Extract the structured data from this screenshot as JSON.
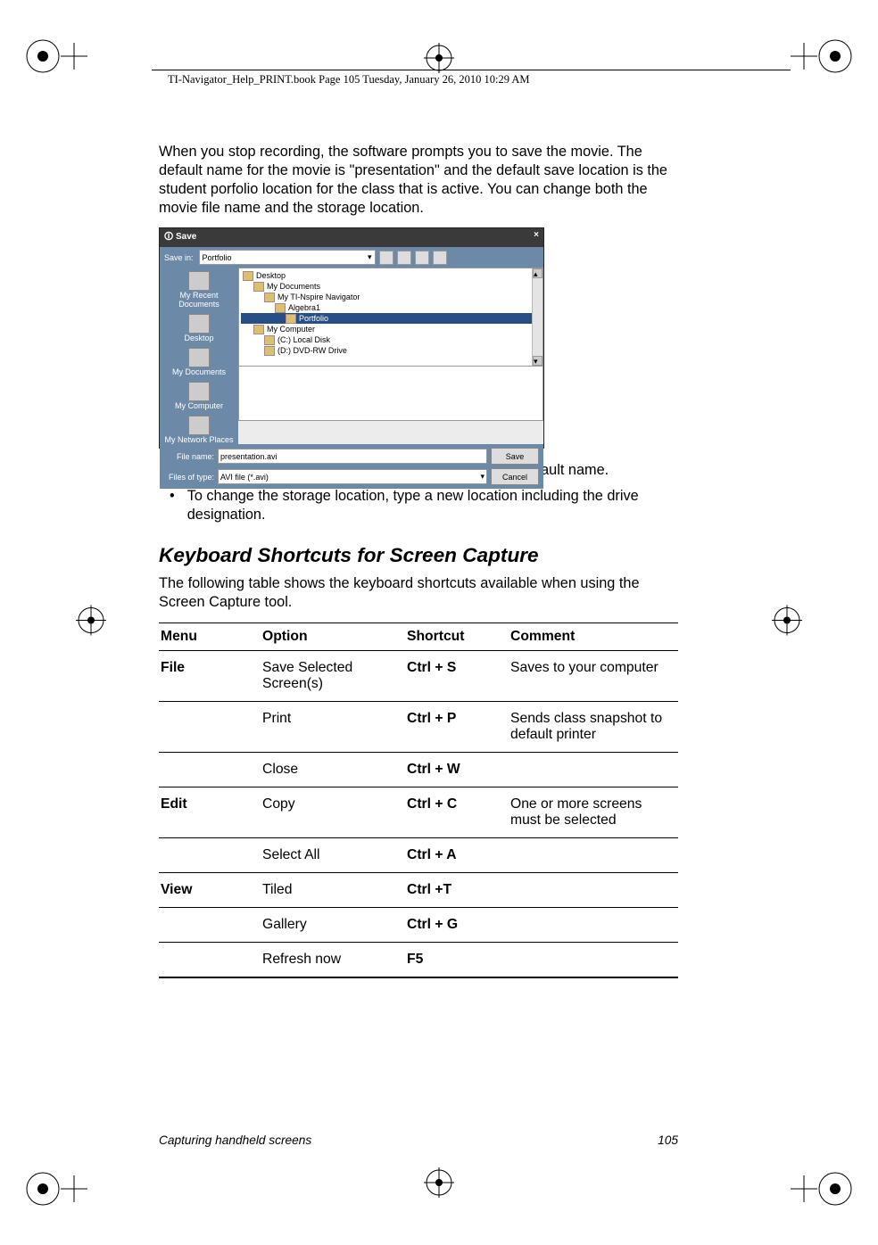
{
  "header": {
    "running_line": "TI-Navigator_Help_PRINT.book  Page 105  Tuesday, January 26, 2010  10:29 AM"
  },
  "intro_paragraph": "When you stop recording, the software prompts you to save the movie. The default name for the movie is \"presentation\" and the default save location is the student porfolio location for the class that is active. You can change both the movie file name and the storage location.",
  "dialog": {
    "title": "Save",
    "close_x": "×",
    "save_in_label": "Save in:",
    "save_in_value": "Portfolio",
    "places": [
      "My Recent Documents",
      "Desktop",
      "My Documents",
      "My Computer",
      "My Network Places"
    ],
    "tree": {
      "root": "Desktop",
      "items": [
        {
          "label": "My Documents",
          "indent": 1
        },
        {
          "label": "My TI-Nspire Navigator",
          "indent": 2
        },
        {
          "label": "Algebra1",
          "indent": 3
        },
        {
          "label": "Portfolio",
          "indent": 4,
          "selected": true
        },
        {
          "label": "My Computer",
          "indent": 1
        },
        {
          "label": "(C:) Local Disk",
          "indent": 2
        },
        {
          "label": "(D:) DVD-RW Drive",
          "indent": 2
        }
      ]
    },
    "file_name_label": "File name:",
    "file_name_value": "presentation.avi",
    "files_of_type_label": "Files of type:",
    "files_of_type_value": "AVI file (*.avi)",
    "save_btn": "Save",
    "cancel_btn": "Cancel"
  },
  "bullets": [
    "To change the file name, type a new name over the default name.",
    "To change the storage location, type a new location including the drive designation."
  ],
  "section_heading": "Keyboard Shortcuts for Screen Capture",
  "section_intro": "The following table shows the keyboard shortcuts available when using the Screen Capture tool.",
  "table": {
    "headers": [
      "Menu",
      "Option",
      "Shortcut",
      "Comment"
    ],
    "rows": [
      {
        "menu": "File",
        "option": "Save Selected Screen(s)",
        "shortcut": "Ctrl + S",
        "comment": "Saves to your computer"
      },
      {
        "menu": "",
        "option": "Print",
        "shortcut": "Ctrl + P",
        "comment": "Sends class snapshot to default printer"
      },
      {
        "menu": "",
        "option": "Close",
        "shortcut": "Ctrl + W",
        "comment": ""
      },
      {
        "menu": "Edit",
        "option": "Copy",
        "shortcut": "Ctrl + C",
        "comment": "One or more screens must be selected"
      },
      {
        "menu": "",
        "option": "Select All",
        "shortcut": "Ctrl + A",
        "comment": ""
      },
      {
        "menu": "View",
        "option": "Tiled",
        "shortcut": "Ctrl +T",
        "comment": ""
      },
      {
        "menu": "",
        "option": "Gallery",
        "shortcut": "Ctrl + G",
        "comment": ""
      },
      {
        "menu": "",
        "option": "Refresh now",
        "shortcut": "F5",
        "comment": ""
      }
    ]
  },
  "footer": {
    "left": "Capturing handheld screens",
    "right": "105"
  }
}
